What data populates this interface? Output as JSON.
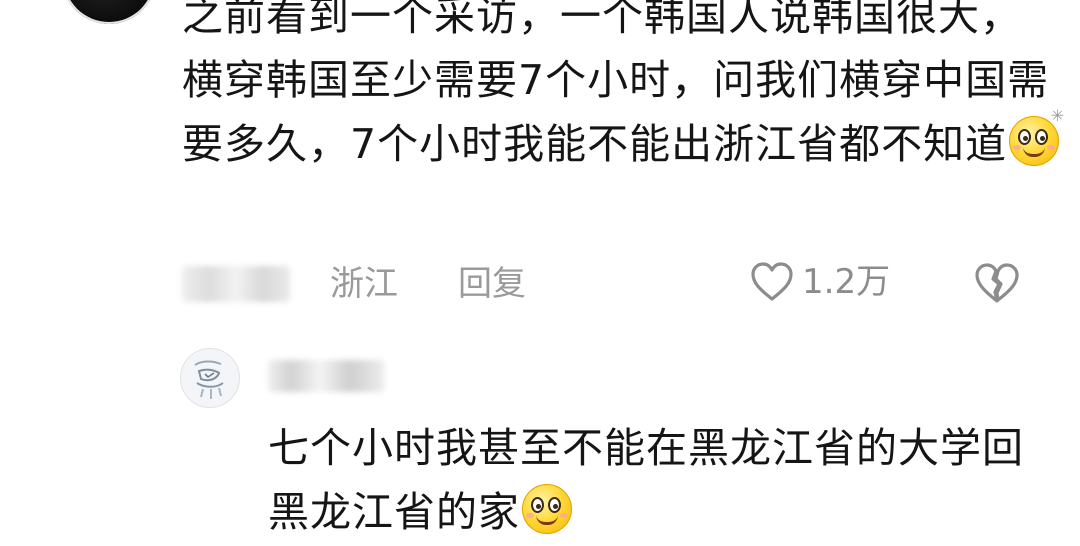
{
  "comment": {
    "text": "之前看到一个采访，一个韩国人说韩国很大，横穿韩国至少需要7个小时，问我们横穿中国需要多久，7个小时我能不能出浙江省都不知道",
    "emoji_icon": "smirk-emoji-icon",
    "location": "浙江",
    "reply_label": "回复",
    "like_count": "1.2万"
  },
  "reply": {
    "text": "七个小时我甚至不能在黑龙江省的大学回黑龙江省的家",
    "emoji_icon": "smile-emoji-icon"
  },
  "colors": {
    "text": "#151515",
    "meta": "#9a9a9a",
    "emoji": "#ffd93a",
    "icon_stroke": "#8c8c8c"
  }
}
